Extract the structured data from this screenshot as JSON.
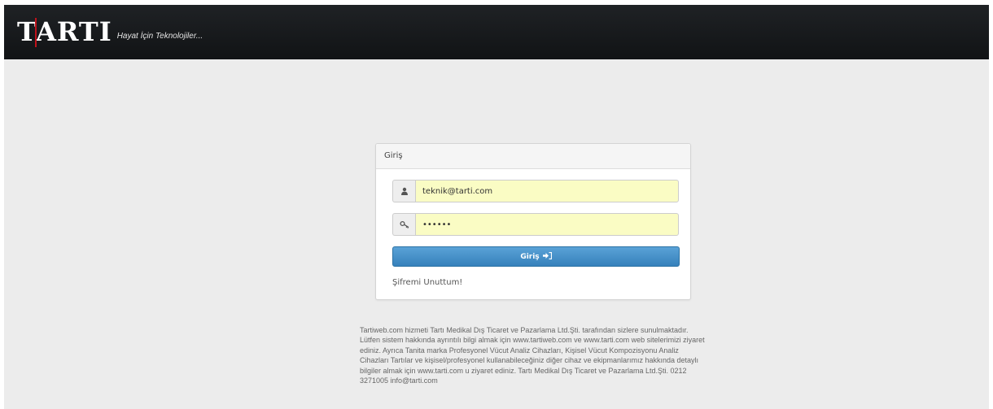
{
  "brand": {
    "logo_text": "TARTI",
    "tagline": "Hayat İçin Teknolojiler..."
  },
  "login_panel": {
    "heading": "Giriş",
    "email": {
      "value": "teknik@tarti.com",
      "icon": "user-icon"
    },
    "password": {
      "value": "••••••",
      "icon": "key-icon"
    },
    "submit_label": "Giriş",
    "submit_icon": "sign-in-icon",
    "forgot_link": "Şifremi Unuttum!"
  },
  "footer": {
    "text": "Tartiweb.com hizmeti Tartı Medikal Dış Ticaret ve Pazarlama Ltd.Şti. tarafından sizlere sunulmaktadır. Lütfen sistem hakkında ayrıntılı bilgi almak için www.tartiweb.com ve www.tarti.com web sitelerimizi ziyaret ediniz. Ayrıca Tanita marka Profesyonel Vücut Analiz Cihazları, Kişisel Vücut Kompozisyonu Analiz Cihazları Tartılar ve kişisel/profesyonel kullanabileceğiniz diğer cihaz ve ekipmanlarımız hakkında detaylı bilgiler almak için www.tarti.com u ziyaret ediniz. Tartı Medikal Dış Ticaret ve Pazarlama Ltd.Şti. 0212 3271005 info@tarti.com"
  },
  "colors": {
    "navbar": "#16181a",
    "background": "#ececec",
    "button": "#428bca",
    "autofill": "#fafcc4",
    "logo_accent": "#c0121b"
  }
}
